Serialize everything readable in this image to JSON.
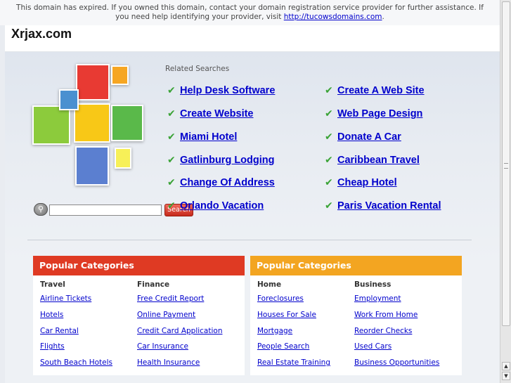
{
  "notice": {
    "text": "This domain has expired. If you owned this domain, contact your domain registration service provider for further assistance. If you need help identifying your provider, visit ",
    "link": "http://tucowsdomains.com",
    "suffix": "."
  },
  "header": {
    "title": "Xrjax.com"
  },
  "search": {
    "button_label": "Search",
    "placeholder": ""
  },
  "related": {
    "title": "Related Searches",
    "left": [
      "Help Desk Software",
      "Create Website",
      "Miami Hotel",
      "Gatlinburg Lodging",
      "Change Of Address",
      "Orlando Vacation"
    ],
    "right": [
      "Create A Web Site",
      "Web Page Design",
      "Donate A Car",
      "Caribbean Travel",
      "Cheap Hotel",
      "Paris Vacation Rental"
    ]
  },
  "categories": {
    "left": {
      "title": "Popular Categories",
      "color": "#df3a23",
      "columns": [
        {
          "title": "Travel",
          "links": [
            "Airline Tickets",
            "Hotels",
            "Car Rental",
            "Flights",
            "South Beach Hotels"
          ]
        },
        {
          "title": "Finance",
          "links": [
            "Free Credit Report",
            "Online Payment",
            "Credit Card Application",
            "Car Insurance",
            "Health Insurance"
          ]
        }
      ]
    },
    "right": {
      "title": "Popular Categories",
      "color": "#f3a521",
      "columns": [
        {
          "title": "Home",
          "links": [
            "Foreclosures",
            "Houses For Sale",
            "Mortgage",
            "People Search",
            "Real Estate Training"
          ]
        },
        {
          "title": "Business",
          "links": [
            "Employment",
            "Work From Home",
            "Reorder Checks",
            "Used Cars",
            "Business Opportunities"
          ]
        }
      ]
    }
  },
  "icons": {
    "check": "check-icon",
    "search": "search-icon"
  }
}
